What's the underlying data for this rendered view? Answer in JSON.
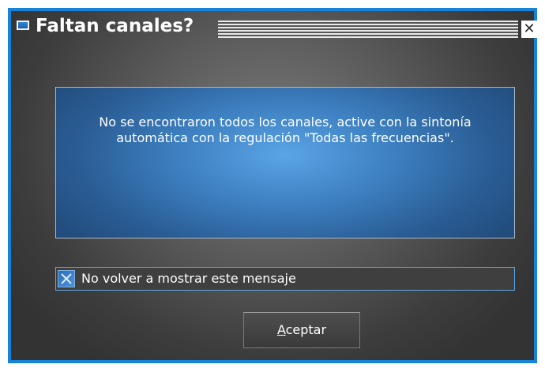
{
  "window": {
    "title": "Faltan canales?",
    "close_glyph": "✕",
    "border_color": "#1683d8",
    "title_icon": "tv-icon"
  },
  "message": {
    "text": "No se encontraron todos los canales, active con la sintonía automática con la regulación \"Todas las frecuencias\"."
  },
  "checkbox": {
    "label": "No volver a mostrar este mensaje",
    "checked": true
  },
  "buttons": {
    "ok": {
      "mnemonic": "A",
      "rest": "ceptar"
    }
  }
}
